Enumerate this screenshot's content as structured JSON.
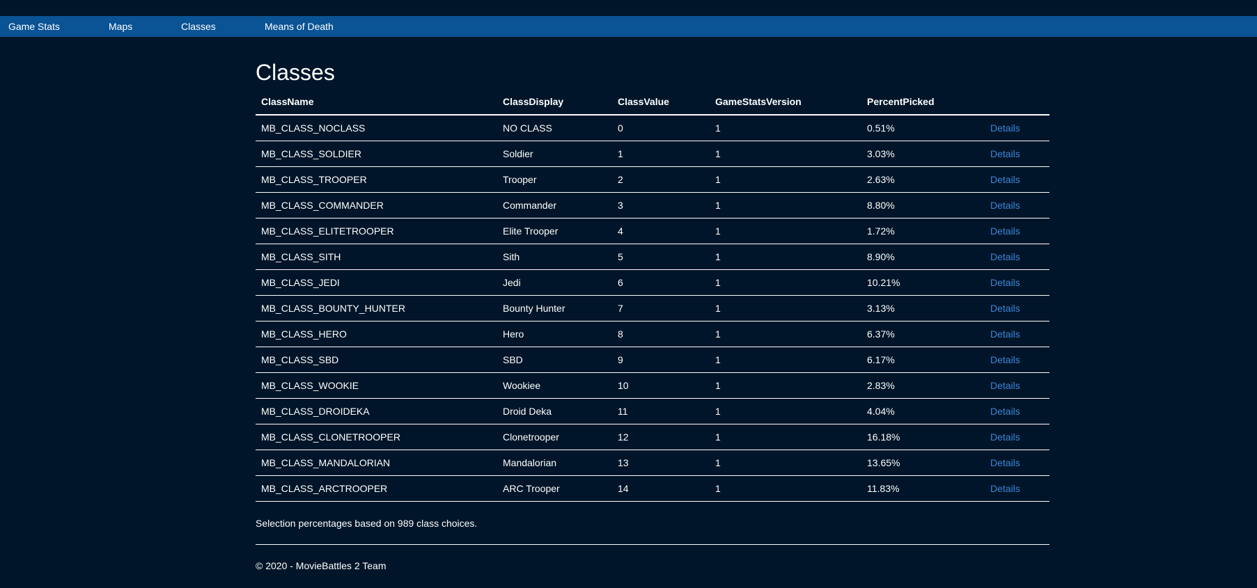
{
  "nav": {
    "items": [
      "Game Stats",
      "Maps",
      "Classes",
      "Means of Death"
    ]
  },
  "page": {
    "title": "Classes",
    "note": "Selection percentages based on 989 class choices.",
    "footer": "© 2020 - MovieBattles 2 Team"
  },
  "table": {
    "headers": [
      "ClassName",
      "ClassDisplay",
      "ClassValue",
      "GameStatsVersion",
      "PercentPicked",
      ""
    ],
    "rows": [
      [
        "MB_CLASS_NOCLASS",
        "NO CLASS",
        "0",
        "1",
        "0.51%",
        "Details"
      ],
      [
        "MB_CLASS_SOLDIER",
        "Soldier",
        "1",
        "1",
        "3.03%",
        "Details"
      ],
      [
        "MB_CLASS_TROOPER",
        "Trooper",
        "2",
        "1",
        "2.63%",
        "Details"
      ],
      [
        "MB_CLASS_COMMANDER",
        "Commander",
        "3",
        "1",
        "8.80%",
        "Details"
      ],
      [
        "MB_CLASS_ELITETROOPER",
        "Elite Trooper",
        "4",
        "1",
        "1.72%",
        "Details"
      ],
      [
        "MB_CLASS_SITH",
        "Sith",
        "5",
        "1",
        "8.90%",
        "Details"
      ],
      [
        "MB_CLASS_JEDI",
        "Jedi",
        "6",
        "1",
        "10.21%",
        "Details"
      ],
      [
        "MB_CLASS_BOUNTY_HUNTER",
        "Bounty Hunter",
        "7",
        "1",
        "3.13%",
        "Details"
      ],
      [
        "MB_CLASS_HERO",
        "Hero",
        "8",
        "1",
        "6.37%",
        "Details"
      ],
      [
        "MB_CLASS_SBD",
        "SBD",
        "9",
        "1",
        "6.17%",
        "Details"
      ],
      [
        "MB_CLASS_WOOKIE",
        "Wookiee",
        "10",
        "1",
        "2.83%",
        "Details"
      ],
      [
        "MB_CLASS_DROIDEKA",
        "Droid Deka",
        "11",
        "1",
        "4.04%",
        "Details"
      ],
      [
        "MB_CLASS_CLONETROOPER",
        "Clonetrooper",
        "12",
        "1",
        "16.18%",
        "Details"
      ],
      [
        "MB_CLASS_MANDALORIAN",
        "Mandalorian",
        "13",
        "1",
        "13.65%",
        "Details"
      ],
      [
        "MB_CLASS_ARCTROOPER",
        "ARC Trooper",
        "14",
        "1",
        "11.83%",
        "Details"
      ]
    ]
  },
  "colors": {
    "background": "#001529",
    "nav_bar": "#0a5394",
    "link": "#3f86d6",
    "text": "#ffffff"
  }
}
